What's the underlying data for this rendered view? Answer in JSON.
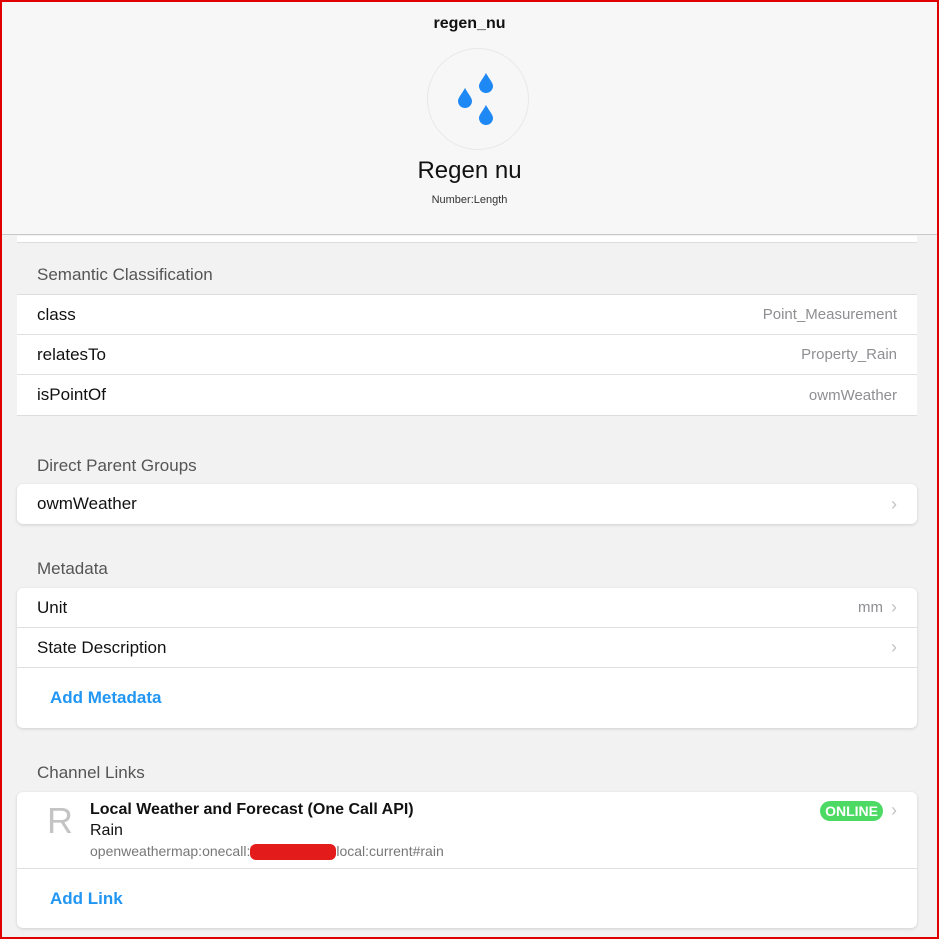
{
  "header": {
    "item_name": "regen_nu",
    "label": "Regen nu",
    "type": "Number:Length",
    "icon": "rain-drops-icon",
    "icon_color": "#1e88f5"
  },
  "semantic": {
    "title": "Semantic Classification",
    "rows": [
      {
        "key": "class",
        "value": "Point_Measurement"
      },
      {
        "key": "relatesTo",
        "value": "Property_Rain"
      },
      {
        "key": "isPointOf",
        "value": "owmWeather"
      }
    ]
  },
  "parents": {
    "title": "Direct Parent Groups",
    "items": [
      "owmWeather"
    ]
  },
  "metadata": {
    "title": "Metadata",
    "rows": [
      {
        "key": "Unit",
        "value": "mm"
      },
      {
        "key": "State Description",
        "value": ""
      }
    ],
    "add_label": "Add Metadata"
  },
  "channels": {
    "title": "Channel Links",
    "link": {
      "initial": "R",
      "thing": "Local Weather and Forecast (One Call API)",
      "channel": "Rain",
      "uid_prefix": "openweathermap:onecall:",
      "uid_suffix": "local:current#rain",
      "status": "ONLINE"
    },
    "add_label": "Add Link"
  }
}
